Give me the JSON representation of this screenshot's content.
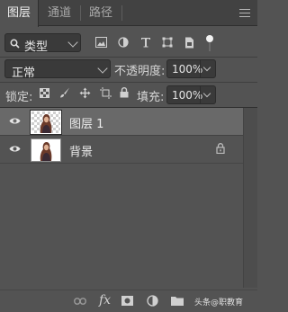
{
  "tabs": [
    {
      "label": "图层"
    },
    {
      "label": "通道"
    },
    {
      "label": "路径"
    }
  ],
  "filter": {
    "kind_label": "类型"
  },
  "blend_mode": {
    "value": "正常"
  },
  "opacity": {
    "label": "不透明度:",
    "value": "100%"
  },
  "lock": {
    "label": "锁定:"
  },
  "fill": {
    "label": "填充:",
    "value": "100%"
  },
  "layers": [
    {
      "name": "图层 1",
      "visible": true,
      "selected": true,
      "transparent_bg": true
    },
    {
      "name": "背景",
      "visible": true,
      "selected": false,
      "locked": true
    }
  ],
  "watermark": {
    "text": "头条@职教育"
  },
  "colors": {
    "panel": "#535353",
    "tabbar": "#424242",
    "selected_row": "#696969",
    "field": "#3a3a3a"
  }
}
